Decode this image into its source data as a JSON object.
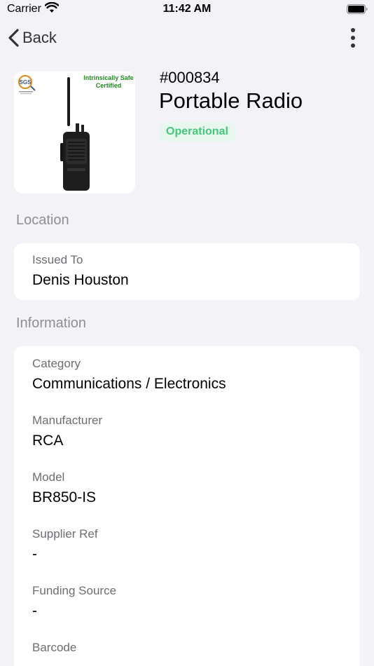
{
  "status_bar": {
    "carrier": "Carrier",
    "time": "11:42 AM"
  },
  "nav": {
    "back_label": "Back"
  },
  "asset": {
    "id": "#000834",
    "name": "Portable Radio",
    "status": "Operational",
    "image": {
      "cert_text": "Intrinsically Safe Certified",
      "logo_text": "SGS"
    }
  },
  "sections": {
    "location": {
      "title": "Location",
      "fields": [
        {
          "label": "Issued To",
          "value": "Denis Houston"
        }
      ]
    },
    "information": {
      "title": "Information",
      "fields": [
        {
          "label": "Category",
          "value": "Communications / Electronics"
        },
        {
          "label": "Manufacturer",
          "value": "RCA"
        },
        {
          "label": "Model",
          "value": "BR850-IS"
        },
        {
          "label": "Supplier Ref",
          "value": "-"
        },
        {
          "label": "Funding Source",
          "value": "-"
        },
        {
          "label": "Barcode",
          "value": ""
        }
      ]
    }
  },
  "colors": {
    "background": "#f2f2f7",
    "status_green": "#44c77a",
    "status_green_bg": "#e8f7ee",
    "label_gray": "#6d6d72",
    "section_gray": "#8e8e93"
  }
}
